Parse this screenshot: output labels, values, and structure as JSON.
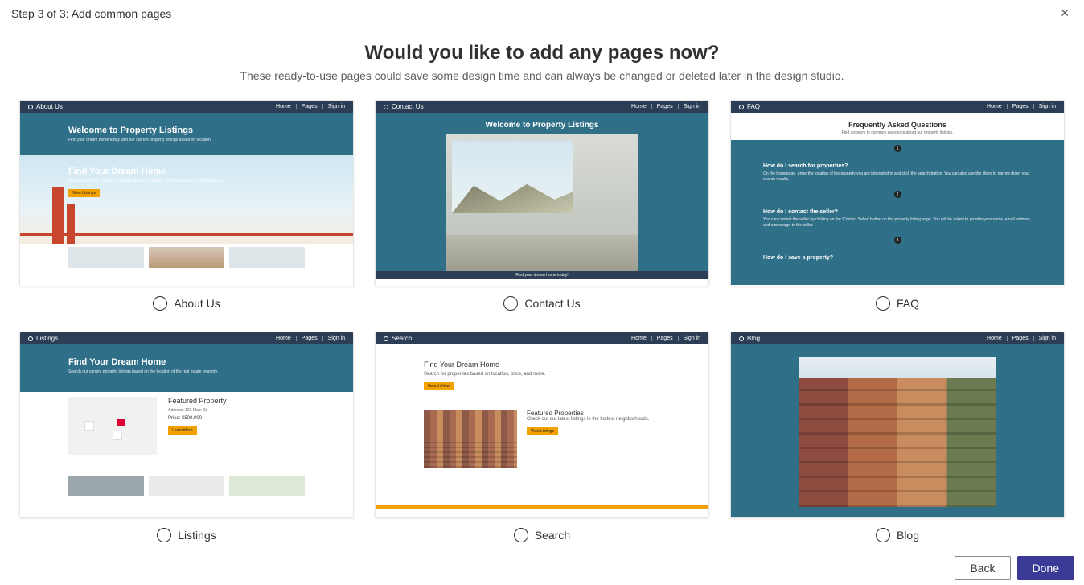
{
  "header": {
    "title": "Step 3 of 3: Add common pages"
  },
  "page": {
    "heading": "Would you like to add any pages now?",
    "subheading": "These ready-to-use pages could save some design time and can always be changed or deleted later in the design studio."
  },
  "nav": {
    "home": "Home",
    "pages": "Pages",
    "signin": "Sign in"
  },
  "cards": {
    "about": {
      "label": "About Us",
      "navTitle": "About Us",
      "heroTitle": "Welcome to Property Listings",
      "heroSub": "Find your dream home today with our current property listings based on location.",
      "ctaTitle": "Find Your Dream Home",
      "ctaSub": "Search our current property listings based on location and find the perfect home for you.",
      "ctaBtn": "View Listings"
    },
    "contact": {
      "label": "Contact Us",
      "navTitle": "Contact Us",
      "heroTitle": "Welcome to Property Listings",
      "footer": "Find your dream home today!"
    },
    "faq": {
      "label": "FAQ",
      "navTitle": "FAQ",
      "title": "Frequently Asked Questions",
      "sub": "Find answers to common questions about our property listings.",
      "q1": "How do I search for properties?",
      "a1": "On the homepage, enter the location of the property you are interested in and click the search button. You can also use the filters to narrow down your search results.",
      "q2": "How do I contact the seller?",
      "a2": "You can contact the seller by clicking on the 'Contact Seller' button on the property listing page. You will be asked to provide your name, email address, and a message to the seller.",
      "q3": "How do I save a property?"
    },
    "listings": {
      "label": "Listings",
      "navTitle": "Listings",
      "heroTitle": "Find Your Dream Home",
      "heroSub": "Search our current property listings based on the location of the real estate property.",
      "featTitle": "Featured Property",
      "addr": "Address: 123 Main St",
      "price": "Price: $500,000",
      "btn": "Learn More"
    },
    "search": {
      "label": "Search",
      "navTitle": "Search",
      "heroTitle": "Find Your Dream Home",
      "heroSub": "Search for properties based on location, price, and more.",
      "btn": "Search Now",
      "fpTitle": "Featured Properties",
      "fpSub": "Check out our latest listings in the hottest neighborhoods.",
      "fpBtn": "View Listings"
    },
    "blog": {
      "label": "Blog",
      "navTitle": "Blog"
    }
  },
  "footer": {
    "back": "Back",
    "done": "Done"
  }
}
